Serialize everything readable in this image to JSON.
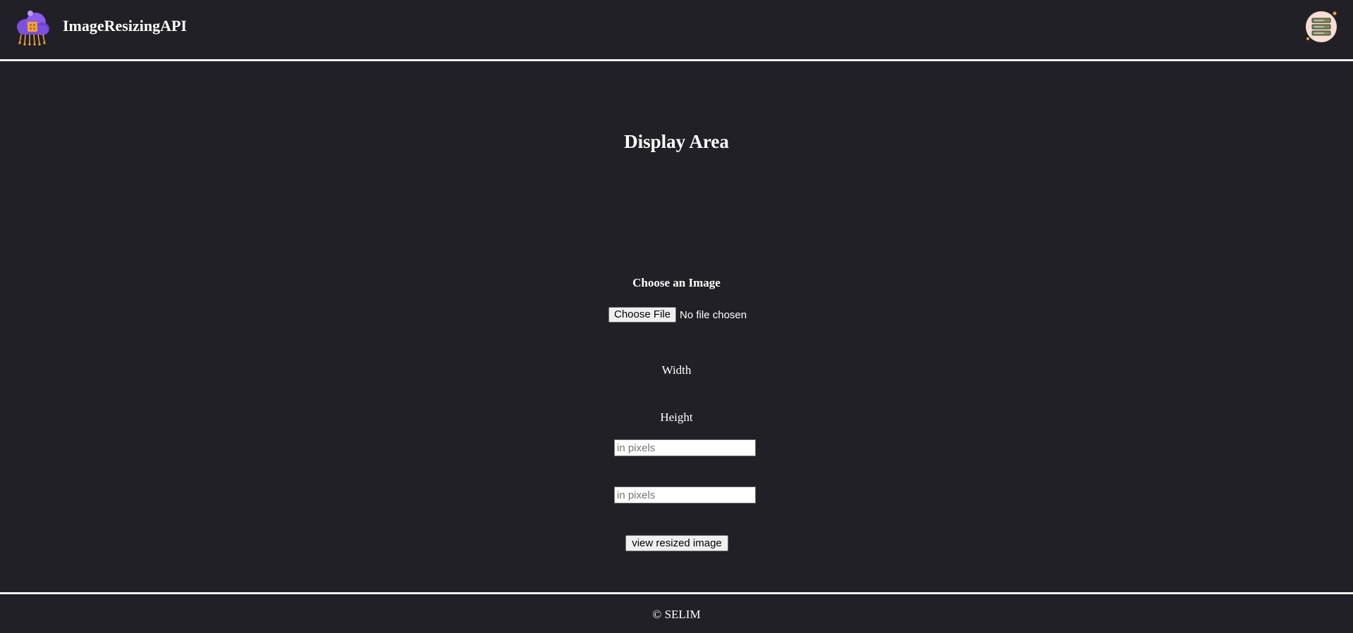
{
  "header": {
    "brand": "ImageResizingAPI",
    "logo_icon": "cloud-chip-icon",
    "menu_icon": "server-stack-icon"
  },
  "main": {
    "display_title": "Display Area",
    "choose_label": "Choose an Image",
    "file_button": "Choose File",
    "file_status": "No file chosen",
    "width_label": "Width",
    "width_placeholder": "in pixels",
    "width_value": "",
    "height_label": "Height",
    "height_placeholder": "in pixels",
    "height_value": "",
    "submit_label": "view resized image"
  },
  "footer": {
    "copyright": "© SELIM"
  },
  "colors": {
    "background": "#212027",
    "rule": "#f2f2f2",
    "logo_cloud": "#7b4fe0",
    "logo_chip": "#f0a33a",
    "menu_badge": "#f7ddd3"
  }
}
